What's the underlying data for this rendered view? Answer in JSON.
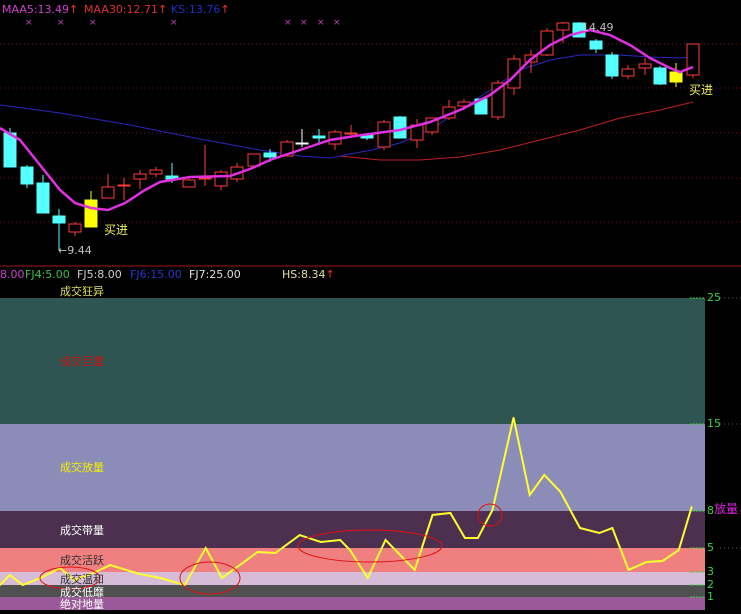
{
  "top_legend": {
    "maa5": "MAA5:13.49",
    "maa30": "MAA30:12.71",
    "ks": "KS:13.76",
    "arrow": "↑"
  },
  "price_labels": {
    "low": "←9.44",
    "high": "14.49",
    "buy1": "买进",
    "buy2": "买进"
  },
  "bottom_legend": {
    "fj3": "8.00",
    "fj4": "FJ4:5.00",
    "fj5": "FJ5:8.00",
    "fj6": "FJ6:15.00",
    "fj7": "FJ7:25.00",
    "hs": "HS:8.34",
    "arrow": "↑",
    "cut_label": "成交狂异"
  },
  "bands": [
    {
      "label": "成交巨量",
      "color": "#2f5552",
      "text_color": "#d01010"
    },
    {
      "label": "成交放量",
      "color": "#8c8cb8",
      "text_color": "#f0f000"
    },
    {
      "label": "成交带量",
      "color": "#4d2f4f",
      "text_color": "#ffffff"
    },
    {
      "label": "成交活跃",
      "color": "#f08080",
      "text_color": "#303030"
    },
    {
      "label": "成交温和",
      "color": "#d6bcd6",
      "text_color": "#303030"
    },
    {
      "label": "成交低靡",
      "color": "#505050",
      "text_color": "#ffffff"
    },
    {
      "label": "绝对地量",
      "color": "#9a5a9a",
      "text_color": "#ffffff"
    }
  ],
  "current_label": "放量",
  "chart_data": {
    "type": "line",
    "title": "HS turnover",
    "yticks": [
      "25",
      "15",
      "8",
      "5",
      "3",
      "2",
      "1"
    ],
    "ytick_values": [
      25,
      15,
      8,
      5,
      3,
      2,
      1
    ],
    "x": [
      0,
      0.6,
      1.4,
      2.5,
      3.7,
      4.6,
      5.9,
      6.8,
      8.6,
      9.9,
      11.4,
      12.7,
      13.7,
      14.8,
      15.9,
      17,
      18.5,
      19.8,
      21,
      21.6,
      22.7,
      23.8,
      25,
      25.6,
      26.7,
      27.8,
      28.7,
      29.5,
      30.4,
      31.7,
      32.7,
      33.6,
      34.6,
      35.8,
      37,
      37.8,
      38.8,
      39.9,
      40.9,
      41.9,
      42.7
    ],
    "values": [
      2,
      2.77,
      2,
      2.54,
      3.33,
      2.38,
      3,
      3.58,
      2.85,
      2.54,
      2,
      5,
      2.54,
      3.58,
      4.67,
      4.58,
      6.05,
      5.49,
      5.65,
      4.83,
      2.54,
      5.65,
      4,
      3.17,
      7.68,
      7.84,
      5.81,
      5.81,
      8.08,
      15.5,
      9.29,
      10.9,
      9.53,
      6.62,
      6.22,
      6.62,
      3.17,
      3.83,
      3.92,
      4.83,
      8.34
    ]
  }
}
